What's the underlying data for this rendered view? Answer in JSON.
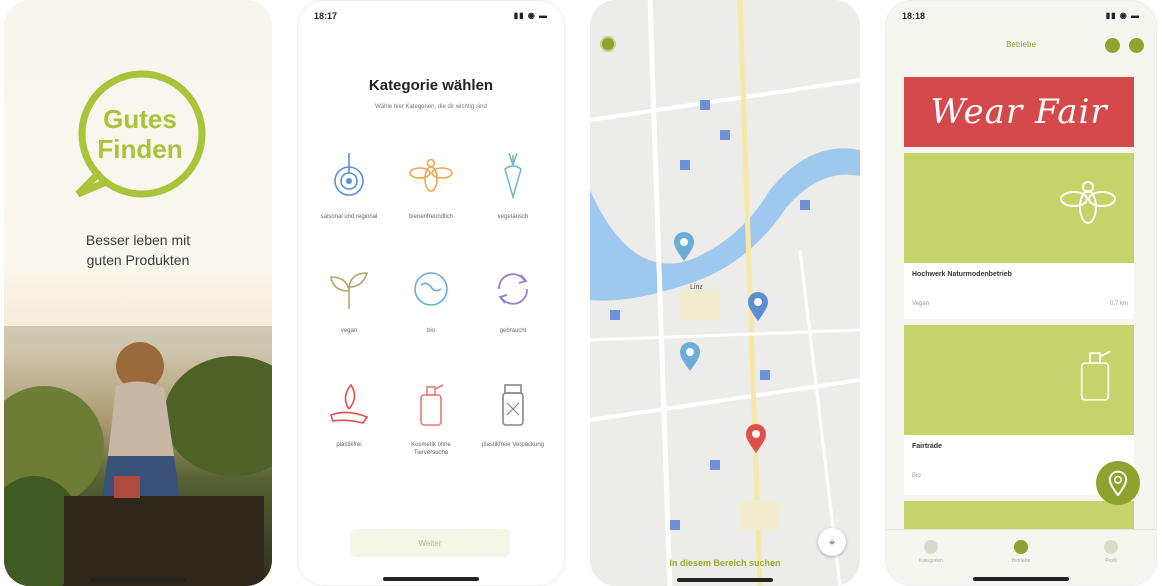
{
  "screen1": {
    "logo_line1": "Gutes",
    "logo_line2": "Finden",
    "tagline_line1": "Besser leben mit",
    "tagline_line2": "guten Produkten",
    "brand_color": "#a9c43a"
  },
  "screen2": {
    "status_time": "18:17",
    "title": "Kategorie wählen",
    "subtitle": "Wähle hier Kategorien, die dir wichtig sind",
    "categories": [
      {
        "label": "saisonal und regional",
        "icon": "location-target-icon",
        "color": "#5a8fd6"
      },
      {
        "label": "bienenfreundlich",
        "icon": "bee-icon",
        "color": "#f0a64a"
      },
      {
        "label": "vegetarisch",
        "icon": "carrot-icon",
        "color": "#7ab8c8"
      },
      {
        "label": "vegan",
        "icon": "sprout-icon",
        "color": "#b8a46a"
      },
      {
        "label": "bio",
        "icon": "bio-globe-icon",
        "color": "#6aaed6"
      },
      {
        "label": "gebraucht",
        "icon": "recycle-icon",
        "color": "#9b7fd0"
      },
      {
        "label": "plastikfrei",
        "icon": "hand-leaf-icon",
        "color": "#e0504a"
      },
      {
        "label": "Kosmetik ohne Tierversuche",
        "icon": "soap-bottle-icon",
        "color": "#e87a7a"
      },
      {
        "label": "plastikfreie Verpackung",
        "icon": "jar-icon",
        "color": "#888888"
      }
    ],
    "weiter_label": "Weiter"
  },
  "screen3": {
    "search_area_label": "In diesem Bereich suchen",
    "city_label": "Linz",
    "pins": [
      {
        "color": "#6aaed6"
      },
      {
        "color": "#5a8fd6"
      },
      {
        "color": "#6aaed6"
      },
      {
        "color": "#e0504a"
      }
    ]
  },
  "screen4": {
    "status_time": "18:18",
    "header_title": "Betriebe",
    "banner_text": "Wear Fair",
    "cards": [
      {
        "name": "Hochwerk Naturmodenbetrieb",
        "meta": "Vegan",
        "dist": "0,7 km"
      },
      {
        "name": "Fairtrade",
        "meta": "Bio",
        "dist": ""
      }
    ],
    "tabs": [
      {
        "label": "Kategorien"
      },
      {
        "label": "Betriebe"
      },
      {
        "label": "Profil"
      }
    ]
  }
}
